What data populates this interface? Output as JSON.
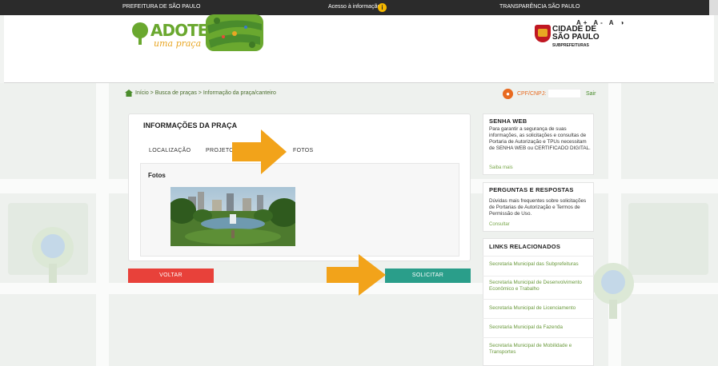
{
  "topbar": {
    "left": "PREFEITURA DE SÃO PAULO",
    "center": "Acesso à informação",
    "info_icon": "i",
    "right": "TRANSPARÊNCIA SÃO PAULO"
  },
  "header": {
    "accessibility": "A+ A- A ◑",
    "logo_title": "ADOTE",
    "logo_sub": "uma praça",
    "city_line1": "CIDADE DE",
    "city_line2": "SÃO PAULO",
    "city_sub": "SUBPREFEITURAS"
  },
  "breadcrumb": {
    "text": "Início  > Busca de praças  > Informação da praça/canteiro"
  },
  "auth": {
    "lock_icon": "lock-icon",
    "cpf_label": "CPF/CNPJ:",
    "cpf_value": "",
    "logout": "Sair"
  },
  "main": {
    "title": "INFORMAÇÕES DA PRAÇA",
    "tabs": [
      "LOCALIZAÇÃO",
      "PROJETO E",
      "FOTOS"
    ],
    "fotos_label": "Fotos",
    "back_button": "VOLTAR",
    "request_button": "SOLICITAR"
  },
  "sidebar": {
    "senha": {
      "title": "SENHA WEB",
      "text": "Para garantir a segurança de suas informações, as solicitações e consultas de Portaria de Autorização e TPUs necessitam de SENHA WEB ou CERTIFICADO DIGITAL.",
      "link": "Saiba mais"
    },
    "faq": {
      "title": "PERGUNTAS E RESPOSTAS",
      "text": "Dúvidas mais frequentes sobre solicitações de Portarias de Autorização e Termos de Permissão de Uso.",
      "link": "Consultar"
    },
    "links": {
      "title": "LINKS RELACIONADOS",
      "items": [
        "Secretaria Municipal das Subprefeituras",
        "Secretaria Municipal de Desenvolvimento Econômico e Trabalho",
        "Secretaria Municipal de Licenciamento",
        "Secretaria Municipal da Fazenda",
        "Secretaria Municipal de Mobilidade e Transportes"
      ]
    }
  },
  "colors": {
    "arrow": "#f2a31a",
    "voltar": "#e8413a",
    "solicitar": "#2a9e8a",
    "brand_green": "#6aa82f"
  }
}
